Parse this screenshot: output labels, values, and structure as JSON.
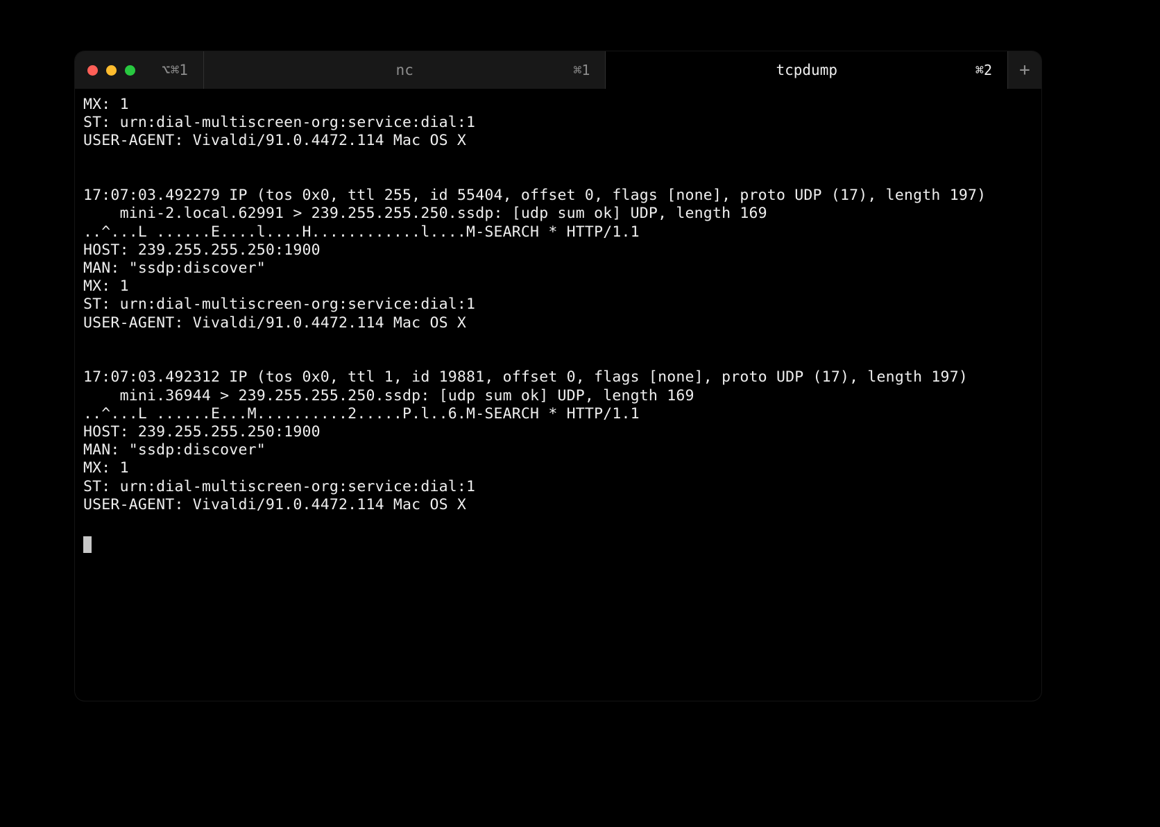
{
  "window": {
    "shortcut": "⌥⌘1"
  },
  "tabs": [
    {
      "title": "nc",
      "shortcut": "⌘1",
      "active": false
    },
    {
      "title": "tcpdump",
      "shortcut": "⌘2",
      "active": true
    }
  ],
  "newTabGlyph": "+",
  "terminal": {
    "lines": [
      "MX: 1",
      "ST: urn:dial-multiscreen-org:service:dial:1",
      "USER-AGENT: Vivaldi/91.0.4472.114 Mac OS X",
      "",
      "",
      "17:07:03.492279 IP (tos 0x0, ttl 255, id 55404, offset 0, flags [none], proto UDP (17), length 197)",
      "    mini-2.local.62991 > 239.255.255.250.ssdp: [udp sum ok] UDP, length 169",
      "..^...L ......E....l....H............l....M-SEARCH * HTTP/1.1",
      "HOST: 239.255.255.250:1900",
      "MAN: \"ssdp:discover\"",
      "MX: 1",
      "ST: urn:dial-multiscreen-org:service:dial:1",
      "USER-AGENT: Vivaldi/91.0.4472.114 Mac OS X",
      "",
      "",
      "17:07:03.492312 IP (tos 0x0, ttl 1, id 19881, offset 0, flags [none], proto UDP (17), length 197)",
      "    mini.36944 > 239.255.255.250.ssdp: [udp sum ok] UDP, length 169",
      "..^...L ......E...M..........2.....P.l..6.M-SEARCH * HTTP/1.1",
      "HOST: 239.255.255.250:1900",
      "MAN: \"ssdp:discover\"",
      "MX: 1",
      "ST: urn:dial-multiscreen-org:service:dial:1",
      "USER-AGENT: Vivaldi/91.0.4472.114 Mac OS X",
      "",
      ""
    ]
  }
}
